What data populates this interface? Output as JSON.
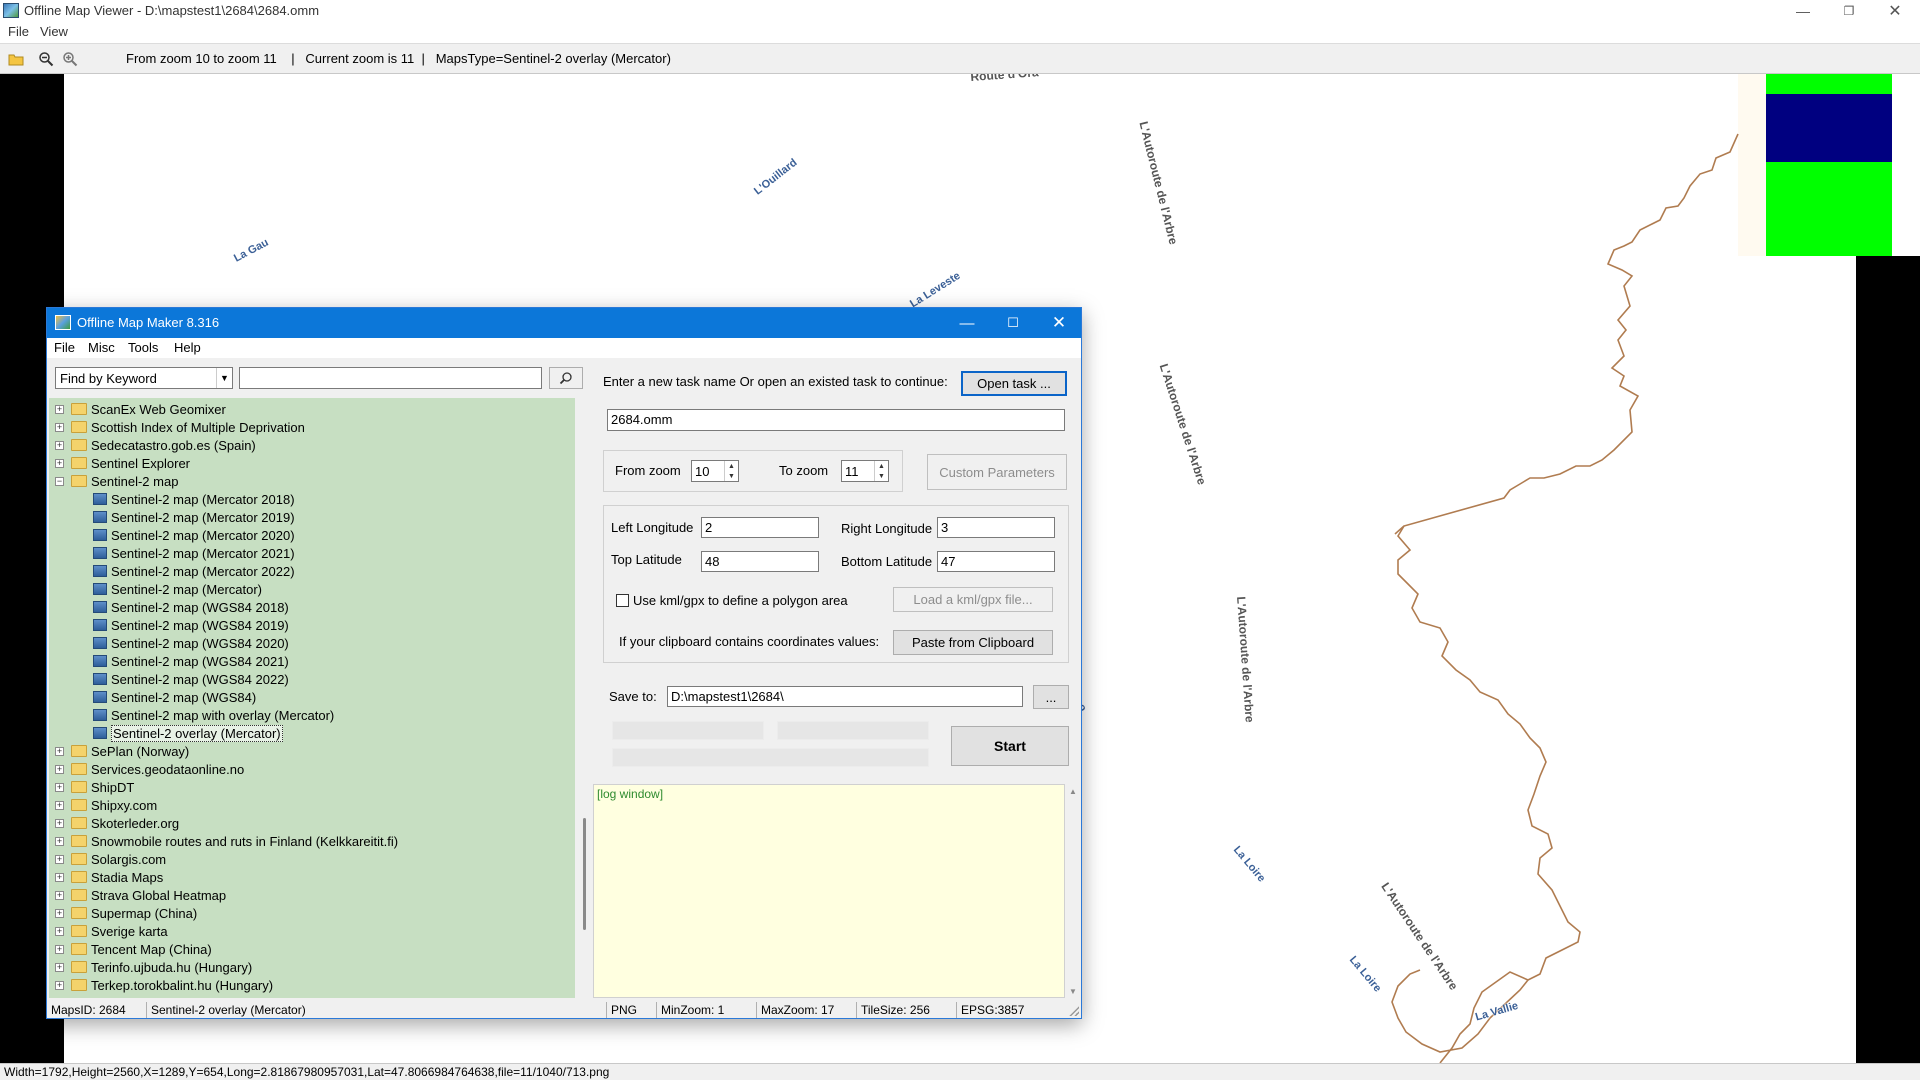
{
  "viewer": {
    "title": "Offline Map Viewer - D:\\mapstest1\\2684\\2684.omm",
    "menu": [
      "File",
      "View"
    ],
    "toolbar": {
      "zoom_info": "From zoom 10 to zoom 11    |   Current zoom is 11  |   MapsType=Sentinel-2 overlay (Mercator)"
    },
    "status": "Width=1792,Height=2560,X=1289,Y=654,Long=2.81867980957031,Lat=47.8066984764638,file=11/1040/713.png"
  },
  "map": {
    "colors": {
      "river": "#b07c50",
      "tile_navy": "#000080",
      "tile_green": "#00ff00",
      "water_label": "#3a5f96"
    },
    "labels": {
      "route": "Route d'Ora",
      "road1": "L'Autoroute de l'Arbre",
      "road2": "L'Autoroute de l'Arbre",
      "road3": "L'Autoroute de l'Arbre",
      "road4": "L'Autoroute de l'Arbre",
      "water1": "La Gau",
      "water2": "L'Ouillard",
      "water3": "La Leveste",
      "water4": "La Loire",
      "water5": "La Loire",
      "water6": "La Vallie",
      "water7": "Lo"
    }
  },
  "omm": {
    "title": "Offline Map Maker 8.316",
    "menu": [
      "File",
      "Misc",
      "Tools",
      "Help"
    ],
    "search": {
      "mode": "Find by Keyword",
      "keyword": ""
    },
    "tree": [
      {
        "label": "ScanEx Web Geomixer",
        "kind": "folder",
        "level": 0
      },
      {
        "label": "Scottish Index of Multiple Deprivation",
        "kind": "folder",
        "level": 0
      },
      {
        "label": "Sedecatastro.gob.es (Spain)",
        "kind": "folder",
        "level": 0
      },
      {
        "label": "Sentinel Explorer",
        "kind": "folder",
        "level": 0
      },
      {
        "label": "Sentinel-2 map",
        "kind": "folder-open",
        "level": 0
      },
      {
        "label": "Sentinel-2 map (Mercator 2018)",
        "kind": "map",
        "level": 1
      },
      {
        "label": "Sentinel-2 map (Mercator 2019)",
        "kind": "map",
        "level": 1
      },
      {
        "label": "Sentinel-2 map (Mercator 2020)",
        "kind": "map",
        "level": 1
      },
      {
        "label": "Sentinel-2 map (Mercator 2021)",
        "kind": "map",
        "level": 1
      },
      {
        "label": "Sentinel-2 map (Mercator 2022)",
        "kind": "map",
        "level": 1
      },
      {
        "label": "Sentinel-2 map (Mercator)",
        "kind": "map",
        "level": 1
      },
      {
        "label": "Sentinel-2 map (WGS84 2018)",
        "kind": "map",
        "level": 1
      },
      {
        "label": "Sentinel-2 map (WGS84 2019)",
        "kind": "map",
        "level": 1
      },
      {
        "label": "Sentinel-2 map (WGS84 2020)",
        "kind": "map",
        "level": 1
      },
      {
        "label": "Sentinel-2 map (WGS84 2021)",
        "kind": "map",
        "level": 1
      },
      {
        "label": "Sentinel-2 map (WGS84 2022)",
        "kind": "map",
        "level": 1
      },
      {
        "label": "Sentinel-2 map (WGS84)",
        "kind": "map",
        "level": 1
      },
      {
        "label": "Sentinel-2 map with overlay (Mercator)",
        "kind": "map",
        "level": 1
      },
      {
        "label": "Sentinel-2 overlay (Mercator)",
        "kind": "map",
        "level": 1,
        "selected": true
      },
      {
        "label": "SePlan (Norway)",
        "kind": "folder",
        "level": 0
      },
      {
        "label": "Services.geodataonline.no",
        "kind": "folder",
        "level": 0
      },
      {
        "label": "ShipDT",
        "kind": "folder",
        "level": 0
      },
      {
        "label": "Shipxy.com",
        "kind": "folder",
        "level": 0
      },
      {
        "label": "Skoterleder.org",
        "kind": "folder",
        "level": 0
      },
      {
        "label": "Snowmobile routes and ruts in Finland (Kelkkareitit.fi)",
        "kind": "folder",
        "level": 0
      },
      {
        "label": "Solargis.com",
        "kind": "folder",
        "level": 0
      },
      {
        "label": "Stadia Maps",
        "kind": "folder",
        "level": 0
      },
      {
        "label": "Strava Global Heatmap",
        "kind": "folder",
        "level": 0
      },
      {
        "label": "Supermap (China)",
        "kind": "folder",
        "level": 0
      },
      {
        "label": "Sverige karta",
        "kind": "folder",
        "level": 0
      },
      {
        "label": "Tencent Map (China)",
        "kind": "folder",
        "level": 0
      },
      {
        "label": "Terinfo.ujbuda.hu (Hungary)",
        "kind": "folder",
        "level": 0
      },
      {
        "label": "Terkep.torokbalint.hu (Hungary)",
        "kind": "folder",
        "level": 0
      }
    ],
    "task_prompt": "Enter a new task name Or open an existed task to continue:",
    "open_task_label": "Open task ...",
    "task_name": "2684.omm",
    "from_zoom_label": "From zoom",
    "from_zoom": "10",
    "to_zoom_label": "To zoom",
    "to_zoom": "11",
    "custom_params_label": "Custom Parameters",
    "left_lon_label": "Left Longitude",
    "left_lon": "2",
    "right_lon_label": "Right Longitude",
    "right_lon": "3",
    "top_lat_label": "Top Latitude",
    "top_lat": "48",
    "bottom_lat_label": "Bottom Latitude",
    "bottom_lat": "47",
    "kml_checkbox_label": "Use kml/gpx to define a polygon area",
    "kml_checked": false,
    "load_kml_label": "Load a kml/gpx file...",
    "clipboard_prompt": "If your clipboard contains coordinates values:",
    "paste_label": "Paste from Clipboard",
    "save_to_label": "Save to:",
    "save_to": "D:\\mapstest1\\2684\\",
    "browse_label": "...",
    "start_label": "Start",
    "log_text": "[log window]",
    "status": {
      "maps_id": "MapsID: 2684",
      "map_name": "Sentinel-2 overlay (Mercator)",
      "format": "PNG",
      "min_zoom": "MinZoom: 1",
      "max_zoom": "MaxZoom: 17",
      "tile_size": "TileSize: 256",
      "epsg": "EPSG:3857"
    }
  }
}
